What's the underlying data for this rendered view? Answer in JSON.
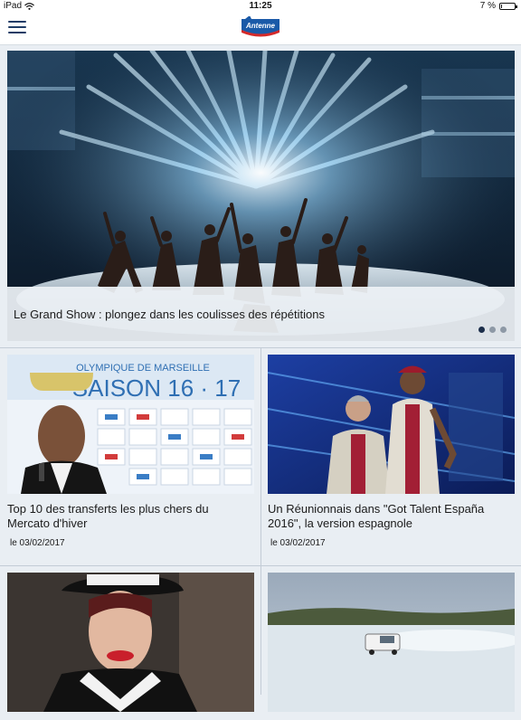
{
  "status_bar": {
    "device": "iPad",
    "time": "11:25",
    "battery": "7 %",
    "battery_level": 0.07
  },
  "nav": {
    "menu_icon": "hamburger-menu-icon",
    "logo_text": "Antenne"
  },
  "hero": {
    "title": "Le Grand Show : plongez dans les coulisses des répétitions",
    "slides_total": 3,
    "active_slide": 1
  },
  "articles": [
    {
      "title": "Top 10 des transferts les plus chers du Mercato d'hiver",
      "date": "le 03/02/2017",
      "thumb_text_1": "OLYMPIQUE DE MARSEILLE",
      "thumb_text_2": "SAISON 16 · 17"
    },
    {
      "title": "Un Réunionnais dans \"Got Talent España 2016\", la version espagnole",
      "date": "le 03/02/2017"
    },
    {
      "title": "",
      "date": ""
    },
    {
      "title": "",
      "date": ""
    }
  ]
}
